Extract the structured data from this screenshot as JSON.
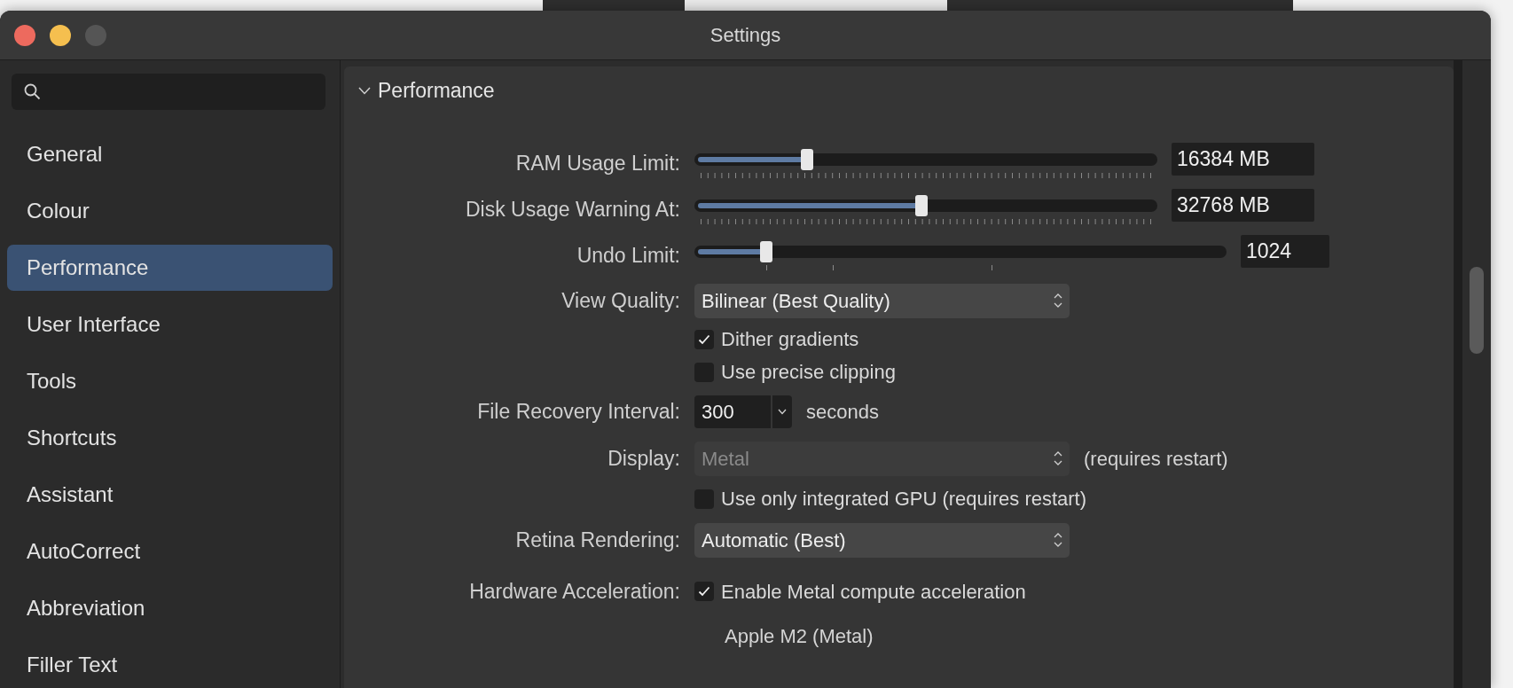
{
  "window": {
    "title": "Settings"
  },
  "sidebar": {
    "items": [
      {
        "label": "General",
        "selected": false
      },
      {
        "label": "Colour",
        "selected": false
      },
      {
        "label": "Performance",
        "selected": true
      },
      {
        "label": "User Interface",
        "selected": false
      },
      {
        "label": "Tools",
        "selected": false
      },
      {
        "label": "Shortcuts",
        "selected": false
      },
      {
        "label": "Assistant",
        "selected": false
      },
      {
        "label": "AutoCorrect",
        "selected": false
      },
      {
        "label": "Abbreviation",
        "selected": false
      },
      {
        "label": "Filler Text",
        "selected": false
      }
    ]
  },
  "section": {
    "title": "Performance",
    "expanded": true
  },
  "settings": [
    {
      "kind": "slider",
      "label": "RAM Usage Limit:",
      "level": 0.24,
      "value": "16384 MB",
      "dense_ticks": true
    },
    {
      "kind": "slider",
      "label": "Disk Usage Warning At:",
      "level": 0.49,
      "value": "32768 MB",
      "dense_ticks": true
    },
    {
      "kind": "slider",
      "label": "Undo Limit:",
      "level": 0.13,
      "value": "1024",
      "dense_ticks": false
    },
    {
      "kind": "select",
      "label": "View Quality:",
      "value": "Bilinear (Best Quality)",
      "disabled": false
    },
    {
      "kind": "checkbox",
      "text": "Dither gradients",
      "checked": true
    },
    {
      "kind": "checkbox",
      "text": "Use precise clipping",
      "checked": false
    },
    {
      "kind": "combo",
      "label": "File Recovery Interval:",
      "value": "300",
      "unit": "seconds"
    },
    {
      "kind": "select",
      "label": "Display:",
      "value": "Metal",
      "disabled": true,
      "note": "(requires restart)"
    },
    {
      "kind": "checkbox",
      "text": "Use only integrated GPU (requires restart)",
      "checked": false
    },
    {
      "kind": "select",
      "label": "Retina Rendering:",
      "value": "Automatic (Best)",
      "disabled": false
    },
    {
      "kind": "checkbox",
      "label": "Hardware Acceleration:",
      "text": "Enable Metal compute acceleration",
      "checked": true
    },
    {
      "kind": "info",
      "text": "Apple M2 (Metal)"
    }
  ]
}
